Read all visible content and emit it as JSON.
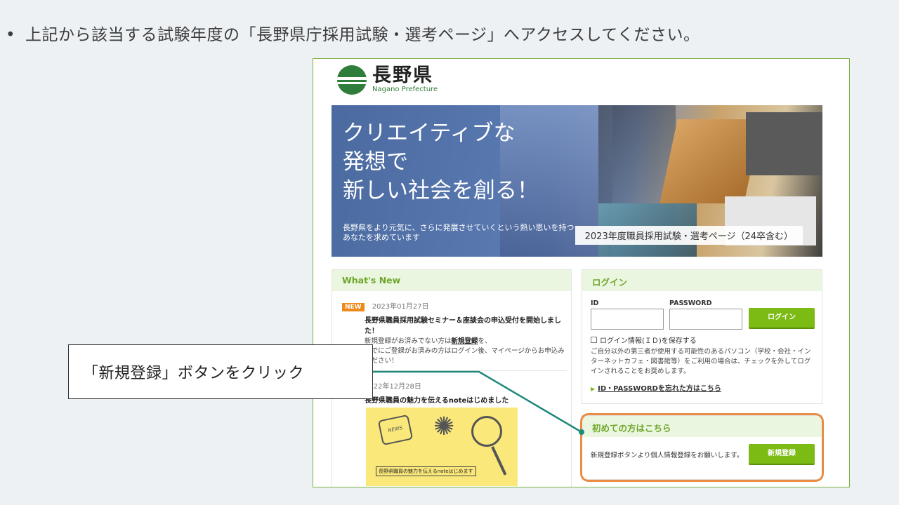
{
  "instruction": {
    "bullet": "•",
    "text": "上記から該当する試験年度の「長野県庁採用試験・選考ページ」へアクセスしてください。"
  },
  "logo": {
    "name": "長野県",
    "sub": "Nagano Prefecture"
  },
  "hero": {
    "title_lines": [
      "クリエイティブな",
      "発想で",
      "新しい社会を創る！"
    ],
    "sub_lines": [
      "長野県をより元気に、さらに発展させていくという熱い思いを持つ",
      "あなたを求めています"
    ],
    "badge": "2023年度職員採用試験・選考ページ（24卒含む）"
  },
  "news": {
    "heading": "What's New",
    "items": [
      {
        "tag": "NEW",
        "date": "2023年01月27日",
        "title": "長野県職員採用試験セミナー＆座談会の申込受付を開始しました！",
        "body_prefix": "新規登録がお済みでない方は",
        "body_link": "新規登録",
        "body_suffix": "を、",
        "body_line2": "すでにご登録がお済みの方はログイン後、マイページからお申込みください！"
      },
      {
        "date": "2022年12月28日",
        "title": "長野県職員の魅力を伝えるnoteはじめました",
        "image_caption": "長野県職員の魅力を伝えるnoteはじめます",
        "image_word": "NEWS"
      }
    ]
  },
  "login": {
    "heading": "ログイン",
    "id_label": "ID",
    "password_label": "PASSWORD",
    "button": "ログイン",
    "save_label": "ログイン情報(ＩＤ)を保存する",
    "note": "ご自分以外の第三者が使用する可能性のあるパソコン（学校・会社・インターネットカフェ・図書館等）をご利用の場合は、チェックを外してログインされることをお奨めします。",
    "forgot": "ID・PASSWORDを忘れた方はこちら"
  },
  "first_time": {
    "heading": "初めての方はこちら",
    "text": "新規登録ボタンより個人情報登録をお願いします。",
    "button": "新規登録"
  },
  "callout": {
    "text": "「新規登録」ボタンをクリック"
  },
  "colors": {
    "accent_green": "#7cba14",
    "highlight_orange": "#e98d45",
    "connector_teal": "#1f8a7b"
  }
}
